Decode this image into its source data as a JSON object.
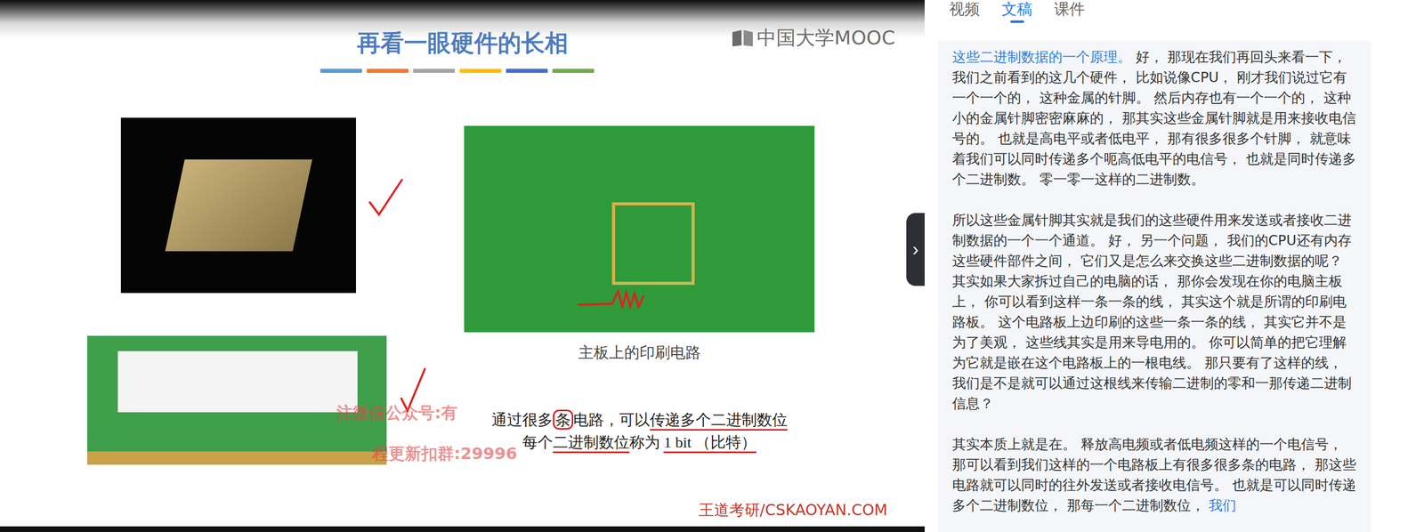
{
  "slide": {
    "title": "再看一眼硬件的长相",
    "logo": "中国大学MOOC",
    "accent_bars": [
      {
        "color": "#5b9bd5"
      },
      {
        "color": "#ed7d31"
      },
      {
        "color": "#a5a5a5"
      },
      {
        "color": "#ffc000"
      },
      {
        "color": "#4472c4"
      },
      {
        "color": "#70ad47"
      }
    ],
    "cpu_photo": {
      "checked": true
    },
    "ram_photo": {
      "checked": true
    },
    "pcb_photo": {
      "caption": "主板上的印刷电路",
      "annotated": true
    },
    "notes": [
      [
        {
          "text": "通过很多",
          "mark": "none"
        },
        {
          "text": "条",
          "mark": "circle"
        },
        {
          "text": "电路，可以",
          "mark": "none"
        },
        {
          "text": "传递多个二进制数位",
          "mark": "underline"
        }
      ],
      [
        {
          "text": "每个",
          "mark": "none"
        },
        {
          "text": "二进制数位",
          "mark": "underline"
        },
        {
          "text": "称为 ",
          "mark": "none"
        },
        {
          "text": "1 bit （比特）",
          "mark": "underline"
        }
      ]
    ],
    "watermark": [
      "注微信公众号:有",
      "程更新扣群:29996"
    ],
    "footer": "王道考研/CSKAOYAN.COM"
  },
  "panel_toggle": "›",
  "tabs": [
    {
      "label": "视频",
      "selected": false
    },
    {
      "label": "文稿",
      "selected": true
    },
    {
      "label": "课件",
      "selected": false
    }
  ],
  "transcript": [
    {
      "segments": [
        {
          "text": "这些二进制数据的一个原理。",
          "highlighted": true
        },
        {
          "text": " 好， 那现在我们再回头来看一下， 我们之前看到的这几个硬件， 比如说像CPU， 刚才我们说过它有一个一个的， 这种金属的针脚。 然后内存也有一个一个的， 这种小的金属针脚密密麻麻的， 那其实这些金属针脚就是用来接收电信号的。 也就是高电平或者低电平， 那有很多很多个针脚， 就意味着我们可以同时传递多个呃高低电平的电信号， 也就是同时传递多个二进制数。 零一零一这样的二进制数。",
          "highlighted": false
        }
      ]
    },
    {
      "segments": [
        {
          "text": "所以这些金属针脚其实就是我们的这些硬件用来发送或者接收二进制数据的一个一个通道。 好， 另一个问题， 我们的CPU还有内存这些硬件部件之间， 它们又是怎么来交换这些二进制数据的呢？ 其实如果大家拆过自己的电脑的话， 那你会发现在你的电脑主板上， 你可以看到这样一条一条的线， 其实这个就是所谓的印刷电路板。 这个电路板上边印刷的这些一条一条的线， 其实它并不是为了美观， 这些线其实是用来导电用的。 你可以简单的把它理解为它就是嵌在这个电路板上的一根电线。 那只要有了这样的线， 我们是不是就可以通过这根线来传输二进制的零和一那传递二进制信息？",
          "highlighted": false
        }
      ]
    },
    {
      "segments": [
        {
          "text": "其实本质上就是在。 释放高电频或者低电频这样的一个电信号， 那可以看到我们这样的一个电路板上有很多很多条的电路， 那这些电路就可以同时的往外发送或者接收电信号。 也就是可以同时传递多个二进制数位， 那每一个二进制数位， ",
          "highlighted": false
        },
        {
          "text": "我们",
          "highlighted": true
        }
      ]
    }
  ]
}
